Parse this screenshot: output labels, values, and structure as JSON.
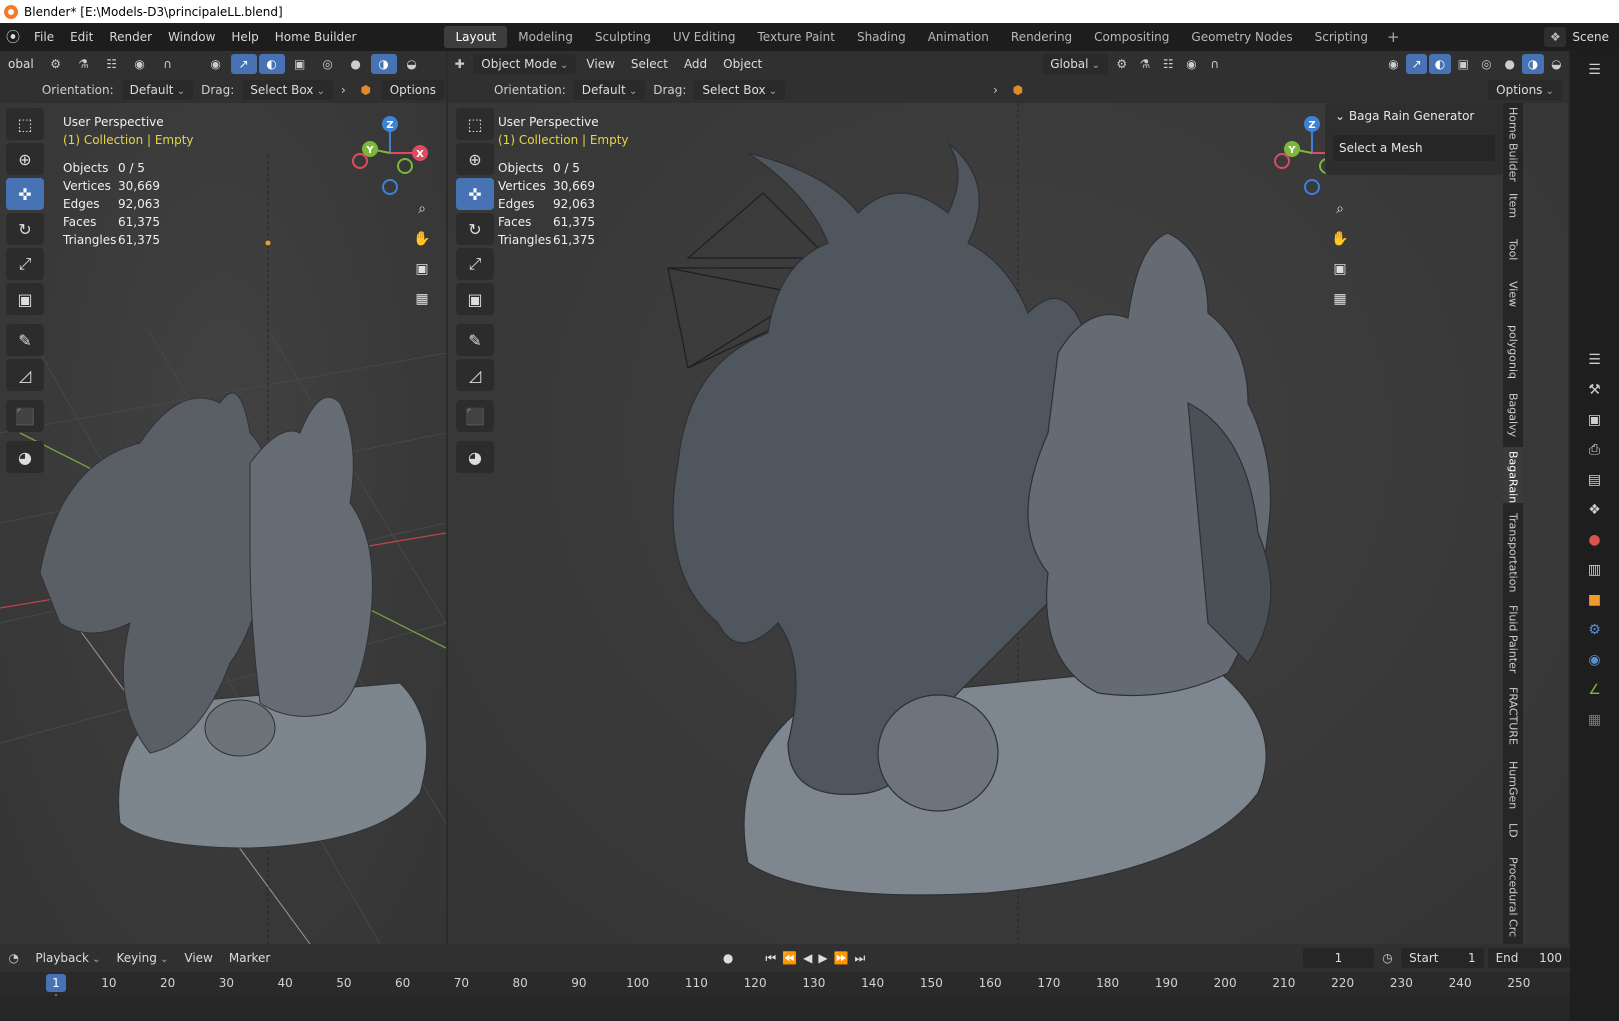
{
  "window": {
    "title": "Blender* [E:\\Models-D3\\principaleLL.blend]"
  },
  "menus": [
    "File",
    "Edit",
    "Render",
    "Window",
    "Help",
    "Home Builder"
  ],
  "workspaces": [
    "Layout",
    "Modeling",
    "Sculpting",
    "UV Editing",
    "Texture Paint",
    "Shading",
    "Animation",
    "Rendering",
    "Compositing",
    "Geometry Nodes",
    "Scripting"
  ],
  "active_workspace": "Layout",
  "scene": {
    "label": "Scene"
  },
  "left_view": {
    "transform_label": "obal",
    "orientation_label": "Orientation:",
    "orientation_value": "Default",
    "drag_label": "Drag:",
    "drag_value": "Select Box",
    "options_label": "Options",
    "overlay_title": "User Perspective",
    "overlay_collection": "(1) Collection | Empty"
  },
  "right_view": {
    "mode": "Object Mode",
    "menu": [
      "View",
      "Select",
      "Add",
      "Object"
    ],
    "transform_value": "Global",
    "orientation_label": "Orientation:",
    "orientation_value": "Default",
    "drag_label": "Drag:",
    "drag_value": "Select Box",
    "options_label": "Options",
    "overlay_title": "User Perspective",
    "overlay_collection": "(1) Collection | Empty"
  },
  "stats": [
    {
      "key": "Objects",
      "value": "0 / 5"
    },
    {
      "key": "Vertices",
      "value": "30,669"
    },
    {
      "key": "Edges",
      "value": "92,063"
    },
    {
      "key": "Faces",
      "value": "61,375"
    },
    {
      "key": "Triangles",
      "value": "61,375"
    }
  ],
  "gizmo": {
    "x": "X",
    "y": "Y",
    "z": "Z"
  },
  "npanel": {
    "title": "Baga Rain Generator",
    "button": "Select a Mesh"
  },
  "sidebar_tabs": [
    "Home Builder",
    "Item",
    "Tool",
    "View",
    "polygoniq",
    "Bagalvy",
    "BagaRain",
    "Transportation",
    "Fluid Painter",
    "FRACTURE",
    "HumGen",
    "LD",
    "Procedural Crc"
  ],
  "active_sidebar_tab": "BagaRain",
  "timeline": {
    "menu": [
      "Playback",
      "Keying",
      "View",
      "Marker"
    ],
    "current_frame": "1",
    "start_label": "Start",
    "start_value": "1",
    "end_label": "End",
    "end_value": "100",
    "ticks": [
      "1",
      "10",
      "20",
      "30",
      "40",
      "50",
      "60",
      "70",
      "80",
      "90",
      "100",
      "110",
      "120",
      "130",
      "140",
      "150",
      "160",
      "170",
      "180",
      "190",
      "200",
      "210",
      "220",
      "230",
      "240",
      "250"
    ]
  },
  "colors": {
    "accent": "#4772b3",
    "axis_x": "#e04a5f",
    "axis_y": "#7bb83a",
    "axis_z": "#3d82d6",
    "collection_text": "#e6d44a"
  }
}
